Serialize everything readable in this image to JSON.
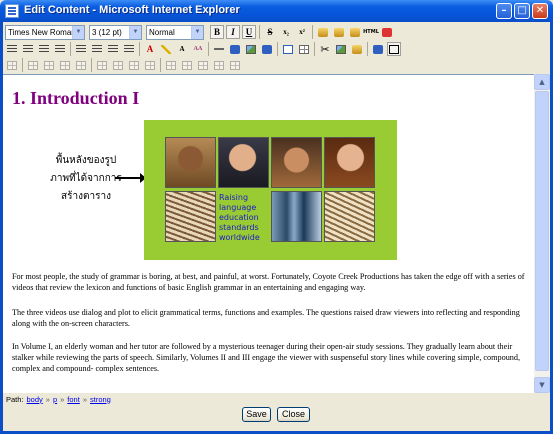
{
  "window": {
    "title": "Edit Content - Microsoft Internet Explorer",
    "minimize_glyph": "–",
    "maximize_glyph": "□",
    "close_glyph": "✕"
  },
  "toolbar": {
    "font_family": "Times New Roman",
    "font_size": "3 (12 pt)",
    "paragraph_format": "Normal",
    "bold": "B",
    "italic": "I",
    "underline": "U",
    "strikethrough": "S",
    "subscript": "x₂",
    "superscript": "x²",
    "font_color": "A",
    "remove_format": "A",
    "text_size": "AA",
    "html_label": "HTML"
  },
  "content": {
    "heading": "1. Introduction I",
    "thai_label_line1": "พื้นหลังของรูป",
    "thai_label_line2": "ภาพที่ได้จากการ",
    "thai_label_line3": "สร้างตาราง",
    "banner_text": "Raising language education standards worldwide",
    "paragraph1": "For most people, the study of grammar is boring, at best, and painful, at worst.  Fortunately, Coyote Creek Productions has taken the edge off with a series of videos that review the lexicon and functions of basic English grammar in an entertaining and engaging way.",
    "paragraph2": "The three videos use dialog and plot to elicit grammatical terms, functions and examples.  The questions raised draw viewers into reflecting and responding along with the on-screen characters.",
    "paragraph3": "In Volume I, an elderly woman and her tutor are followed by a mysterious teenager during their open-air study sessions.  They gradually learn about their stalker while reviewing the parts of speech.  Similarly, Volumes II and III engage the viewer with suspenseful story lines while covering simple, compound, complex and compound- complex sentences."
  },
  "pathbar": {
    "label": "Path:",
    "crumbs": [
      "body",
      "p",
      "font",
      "strong"
    ],
    "separator": "»"
  },
  "buttons": {
    "save": "Save",
    "close": "Close"
  },
  "colors": {
    "heading": "#800080",
    "banner_background": "#99cc33",
    "banner_text": "#1a1acc",
    "title_bar": "#0a5ee0"
  }
}
